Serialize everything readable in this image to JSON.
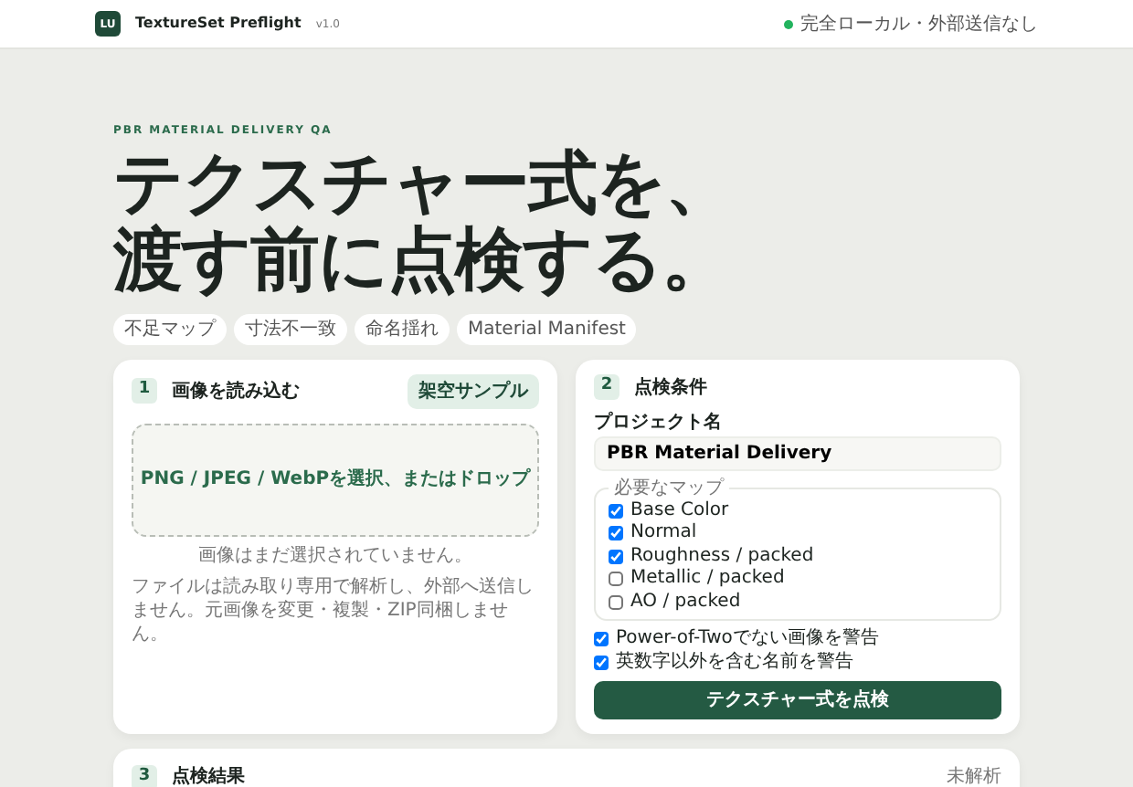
{
  "header": {
    "logo_text": "LU",
    "app_name": "TextureSet Preflight",
    "version": "v1.0",
    "status_text": "完全ローカル・外部送信なし"
  },
  "hero": {
    "eyebrow": "PBR MATERIAL DELIVERY QA",
    "title_lines": [
      "テクスチャー式を、",
      "渡す前に点検する。"
    ],
    "chips": [
      "不足マップ",
      "寸法不一致",
      "命名揺れ",
      "Material Manifest"
    ]
  },
  "upload_card": {
    "step": "1",
    "title": "画像を読み込む",
    "sample_button": "架空サンプル",
    "dropzone_text": "PNG / JPEG / WebPを選択、またはドロップ",
    "status_text": "画像はまだ選択されていません。",
    "note": "ファイルは読み取り専用で解析し、外部へ送信しません。元画像を変更・複製・ZIP同梱しません。"
  },
  "settings_card": {
    "step": "2",
    "title": "点検条件",
    "project_label": "プロジェクト名",
    "project_value": "PBR Material Delivery",
    "maps_legend": "必要なマップ",
    "maps": [
      {
        "label": "Base Color",
        "checked": true
      },
      {
        "label": "Normal",
        "checked": true
      },
      {
        "label": "Roughness / packed",
        "checked": true
      },
      {
        "label": "Metallic / packed",
        "checked": false
      },
      {
        "label": "AO / packed",
        "checked": false
      }
    ],
    "options": [
      {
        "label": "Power-of-Twoでない画像を警告",
        "checked": true
      },
      {
        "label": "英数字以外を含む名前を警告",
        "checked": true
      }
    ],
    "submit_button": "テクスチャー式を点検"
  },
  "results_card": {
    "step": "3",
    "title": "点検結果",
    "status_text": "未解析"
  }
}
